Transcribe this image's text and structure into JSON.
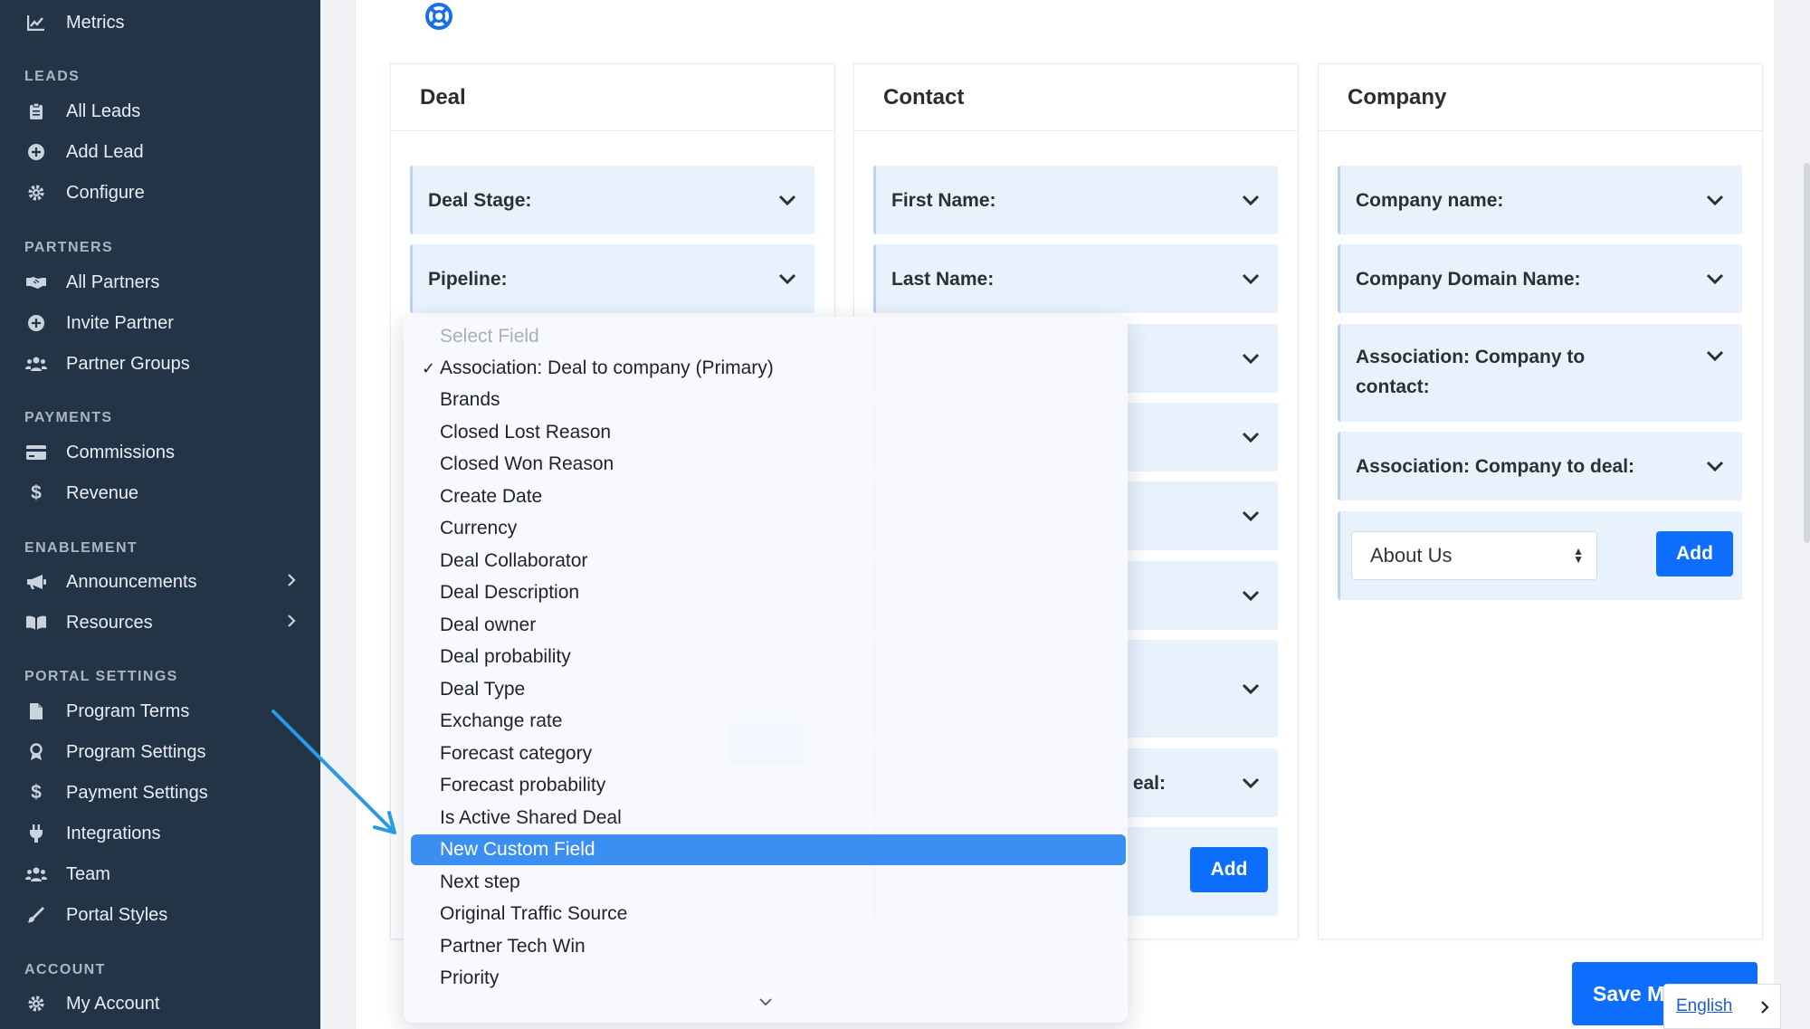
{
  "sidebar": {
    "metrics": "Metrics",
    "sections": {
      "leads": "LEADS",
      "partners": "PARTNERS",
      "payments": "PAYMENTS",
      "enablement": "ENABLEMENT",
      "portal_settings": "PORTAL SETTINGS",
      "account": "ACCOUNT"
    },
    "items": {
      "all_leads": "All Leads",
      "add_lead": "Add Lead",
      "configure": "Configure",
      "all_partners": "All Partners",
      "invite_partner": "Invite Partner",
      "partner_groups": "Partner Groups",
      "commissions": "Commissions",
      "revenue": "Revenue",
      "announcements": "Announcements",
      "resources": "Resources",
      "program_terms": "Program Terms",
      "program_settings": "Program Settings",
      "payment_settings": "Payment Settings",
      "integrations": "Integrations",
      "team": "Team",
      "portal_styles": "Portal Styles",
      "my_account": "My Account"
    }
  },
  "panels": {
    "deal": {
      "title": "Deal",
      "fields": [
        "Deal Stage:",
        "Pipeline:"
      ]
    },
    "contact": {
      "title": "Contact",
      "fields": [
        "First Name:",
        "Last Name:",
        "eal:"
      ],
      "add_label": "Add"
    },
    "company": {
      "title": "Company",
      "fields": [
        "Company name:",
        "Company Domain Name:",
        "Association: Company to contact:",
        "Association: Company to deal:"
      ],
      "select_value": "About Us",
      "add_label": "Add"
    }
  },
  "dropdown": {
    "placeholder": "Select Field",
    "check_mark": "✓",
    "checked": "Association: Deal to company (Primary)",
    "options": [
      "Brands",
      "Closed Lost Reason",
      "Closed Won Reason",
      "Create Date",
      "Currency",
      "Deal Collaborator",
      "Deal Description",
      "Deal owner",
      "Deal probability",
      "Deal Type",
      "Exchange rate",
      "Forecast category",
      "Forecast probability",
      "Is Active Shared Deal",
      "New Custom Field",
      "Next step",
      "Original Traffic Source",
      "Partner Tech Win",
      "Priority"
    ],
    "highlighted": "New Custom Field"
  },
  "footer": {
    "save_label": "Save M",
    "language": "English"
  },
  "colors": {
    "sidebar_bg": "#243447",
    "primary": "#0d6efd",
    "field_bg": "#e8f2fd",
    "highlight": "#3c8ff2",
    "arrow": "#2b9be0"
  }
}
